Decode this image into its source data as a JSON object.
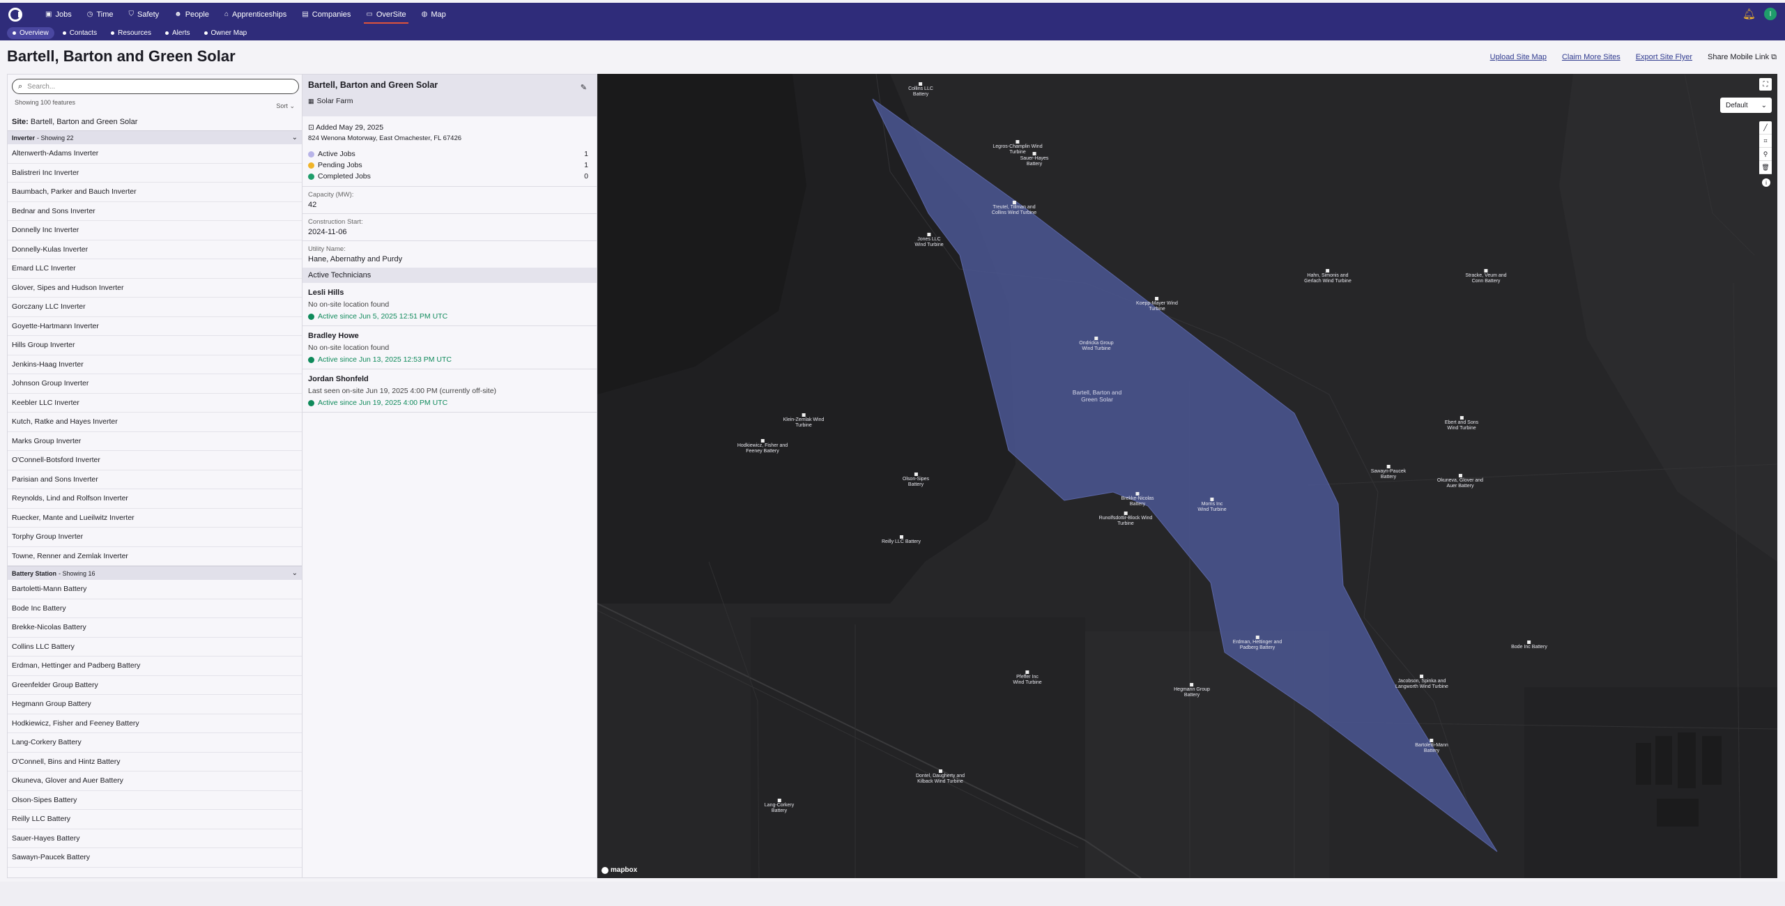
{
  "nav": {
    "items": [
      {
        "label": "Jobs",
        "icon": "briefcase-icon",
        "glyph": "▣",
        "active": false
      },
      {
        "label": "Time",
        "icon": "clock-icon",
        "glyph": "◷",
        "active": false
      },
      {
        "label": "Safety",
        "icon": "shield-icon",
        "glyph": "⛉",
        "active": false
      },
      {
        "label": "People",
        "icon": "people-icon",
        "glyph": "☻",
        "active": false
      },
      {
        "label": "Apprenticeships",
        "icon": "graduation-cap-icon",
        "glyph": "⌂",
        "active": false
      },
      {
        "label": "Companies",
        "icon": "building-icon",
        "glyph": "▤",
        "active": false
      },
      {
        "label": "OverSite",
        "icon": "oversite-icon",
        "glyph": "▭",
        "active": true
      },
      {
        "label": "Map",
        "icon": "globe-icon",
        "glyph": "◍",
        "active": false
      }
    ],
    "avatar_initial": "I"
  },
  "subnav": {
    "items": [
      {
        "label": "Overview",
        "active": true
      },
      {
        "label": "Contacts",
        "active": false
      },
      {
        "label": "Resources",
        "active": false
      },
      {
        "label": "Alerts",
        "active": false
      },
      {
        "label": "Owner Map",
        "active": false
      }
    ]
  },
  "header": {
    "title": "Bartell, Barton and Green Solar",
    "links": [
      "Upload Site Map",
      "Claim More Sites",
      "Export Site Flyer"
    ],
    "share_label": "Share Mobile Link"
  },
  "list": {
    "search_placeholder": "Search...",
    "showing": "Showing 100 features",
    "sort_label": "Sort",
    "site_prefix": "Site:",
    "site_name": "Bartell, Barton and Green Solar",
    "groups": [
      {
        "name": "Inverter",
        "count_label": "- Showing 22",
        "items": [
          "Altenwerth-Adams Inverter",
          "Balistreri Inc Inverter",
          "Baumbach, Parker and Bauch Inverter",
          "Bednar and Sons Inverter",
          "Donnelly Inc Inverter",
          "Donnelly-Kulas Inverter",
          "Emard LLC Inverter",
          "Glover, Sipes and Hudson Inverter",
          "Gorczany LLC Inverter",
          "Goyette-Hartmann Inverter",
          "Hills Group Inverter",
          "Jenkins-Haag Inverter",
          "Johnson Group Inverter",
          "Keebler LLC Inverter",
          "Kutch, Ratke and Hayes Inverter",
          "Marks Group Inverter",
          "O'Connell-Botsford Inverter",
          "Parisian and Sons Inverter",
          "Reynolds, Lind and Rolfson Inverter",
          "Ruecker, Mante and Lueilwitz Inverter",
          "Torphy Group Inverter",
          "Towne, Renner and Zemlak Inverter"
        ]
      },
      {
        "name": "Battery Station",
        "count_label": "- Showing 16",
        "items": [
          "Bartoletti-Mann Battery",
          "Bode Inc Battery",
          "Brekke-Nicolas Battery",
          "Collins LLC Battery",
          "Erdman, Hettinger and Padberg Battery",
          "Greenfelder Group Battery",
          "Hegmann Group Battery",
          "Hodkiewicz, Fisher and Feeney Battery",
          "Lang-Corkery Battery",
          "O'Connell, Bins and Hintz Battery",
          "Okuneva, Glover and Auer Battery",
          "Olson-Sipes Battery",
          "Reilly LLC Battery",
          "Sauer-Hayes Battery",
          "Sawayn-Paucek Battery"
        ]
      }
    ]
  },
  "detail": {
    "title": "Bartell, Barton and Green Solar",
    "type": "Solar Farm",
    "added": "Added May 29, 2025",
    "address": "824 Wenona Motorway, East Omachester, FL 67426",
    "jobs": [
      {
        "label": "Active Jobs",
        "count": "1",
        "color": "#b8b4e8"
      },
      {
        "label": "Pending Jobs",
        "count": "1",
        "color": "#f0b429"
      },
      {
        "label": "Completed Jobs",
        "count": "0",
        "color": "#1f9d6b"
      }
    ],
    "capacity_label": "Capacity (MW):",
    "capacity": "42",
    "construction_label": "Construction Start:",
    "construction": "2024-11-06",
    "utility_label": "Utility Name:",
    "utility": "Hane, Abernathy and Purdy",
    "technicians_header": "Active Technicians",
    "technicians": [
      {
        "name": "Lesli Hills",
        "location": "No on-site location found",
        "active": "Active since Jun 5, 2025 12:51 PM UTC"
      },
      {
        "name": "Bradley Howe",
        "location": "No on-site location found",
        "active": "Active since Jun 13, 2025 12:53 PM UTC"
      },
      {
        "name": "Jordan Shonfeld",
        "location": "Last seen on-site Jun 19, 2025 4:00 PM (currently off-site)",
        "active": "Active since Jun 19, 2025 4:00 PM UTC"
      }
    ]
  },
  "map": {
    "style_select": "Default",
    "attribution": "mapbox",
    "site_label": "Bartell, Barton and Green Solar",
    "polygon_color": "#4a5590",
    "features": [
      {
        "label": "Collins LLC Battery"
      },
      {
        "label": "Legros-Champlin Wind Turbine"
      },
      {
        "label": "Sauer-Hayes Battery"
      },
      {
        "label": "Treutel, Tillman and Collins Wind Turbine"
      },
      {
        "label": "Jones LLC Wind Turbine"
      },
      {
        "label": "Hahn, Simonis and Gerlach Wind Turbine"
      },
      {
        "label": "Stracke, Veum and Conn Battery"
      },
      {
        "label": "Koepp-Mayer Wind Turbine"
      },
      {
        "label": "Ondricka Group Wind Turbine"
      },
      {
        "label": "Klein-Zemlak Wind Turbine"
      },
      {
        "label": "Hodkiewicz, Fisher and Feeney Battery"
      },
      {
        "label": "Ebert and Sons Wind Turbine"
      },
      {
        "label": "Sawayn-Paucek Battery"
      },
      {
        "label": "Okuneva, Glover and Auer Battery"
      },
      {
        "label": "Olson-Sipes Battery"
      },
      {
        "label": "Brekke-Nicolas Battery"
      },
      {
        "label": "Morris Inc Wind Turbine"
      },
      {
        "label": "Runolfsdottir-Block Wind Turbine"
      },
      {
        "label": "Reilly LLC Battery"
      },
      {
        "label": "Erdman, Hettinger and Padberg Battery"
      },
      {
        "label": "Bode Inc Battery"
      },
      {
        "label": "Pfeffer Inc Wind Turbine"
      },
      {
        "label": "Hegmann Group Battery"
      },
      {
        "label": "Jacobson, Spinka and Langworth Wind Turbine"
      },
      {
        "label": "Bartoletti-Mann Battery"
      },
      {
        "label": "Dontel, Daugherty and Kilback Wind Turbine"
      },
      {
        "label": "Lang-Corkery Battery"
      }
    ]
  }
}
